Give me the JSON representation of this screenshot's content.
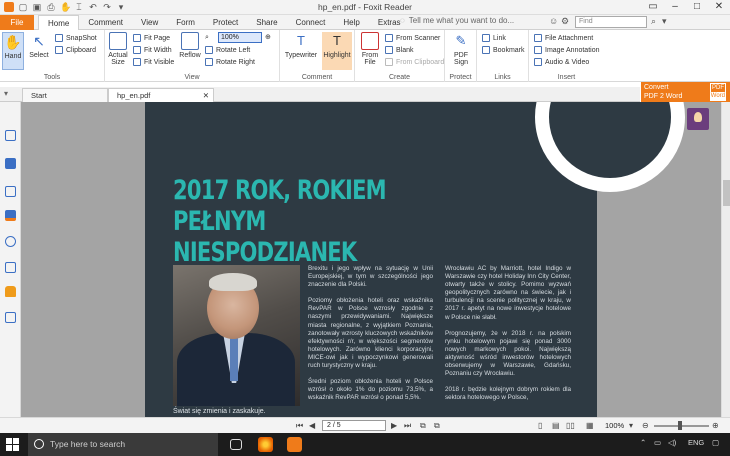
{
  "window": {
    "title": "hp_en.pdf - Foxit Reader"
  },
  "ribbon_tabs": [
    "File",
    "Home",
    "Comment",
    "View",
    "Form",
    "Protect",
    "Share",
    "Connect",
    "Help",
    "Extras"
  ],
  "active_tab": "Home",
  "tell_me": "Tell me what you want to do...",
  "find": {
    "placeholder": "Find"
  },
  "ribbon": {
    "tools": {
      "hand": "Hand",
      "select": "Select",
      "snapshot": "SnapShot",
      "clipboard": "Clipboard",
      "label": "Tools"
    },
    "view": {
      "actual_size": "Actual Size",
      "fit_page": "Fit Page",
      "fit_width": "Fit Width",
      "fit_visible": "Fit Visible",
      "reflow": "Reflow",
      "zoom": "100%",
      "rotate_left": "Rotate Left",
      "rotate_right": "Rotate Right",
      "label": "View"
    },
    "comment": {
      "typewriter": "Typewriter",
      "highlight": "Highlight",
      "label": "Comment"
    },
    "create": {
      "from_file": "From File",
      "from_scanner": "From Scanner",
      "blank": "Blank",
      "from_clipboard": "From Clipboard",
      "label": "Create"
    },
    "protect": {
      "pdf_sign": "PDF Sign",
      "label": "Protect"
    },
    "links": {
      "link": "Link",
      "bookmark": "Bookmark",
      "label": "Links"
    },
    "insert": {
      "file_attachment": "File Attachment",
      "image_annotation": "Image Annotation",
      "audio_video": "Audio & Video",
      "label": "Insert"
    }
  },
  "convert": {
    "line1": "Convert",
    "line2": "PDF 2 Word",
    "badge1": "PDF",
    "badge2": "Word"
  },
  "doc_tabs": [
    "Start",
    "hp_en.pdf"
  ],
  "document": {
    "title_line1": "2017 ROK, ROKIEM PEŁNYM",
    "title_line2": "NIESPODZIANEK",
    "col1": [
      "Brexitu i jego wpływ na sytuację w Unii Europejskiej, w tym w szczególności jego znaczenie dla Polski.",
      "Poziomy obłożenia hoteli oraz wskaźnika RevPAR w Polsce wzrosły zgodnie z naszymi przewidywaniami. Największe miasta regionalne, z wyjątkiem Poznania, zanotowały wzrosty kluczowych wskaźników efektywności r/r, w większości segmentów hotelowych. Zarówno klienci korporacyjni, MICE-owi jak i wypoczynkowi generowali ruch turystyczny w kraju.",
      "Średni poziom obłożenia hoteli w Polsce wzrósł o około 1% do poziomu 73,5%, a wskaźnik RevPAR wzrósł o ponad 5,5%."
    ],
    "col2": [
      "Wrocławiu AC by Marriott, hotel Indigo w Warszawie czy hotel Holiday Inn City Center, otwarty także w stolicy. Pomimo wyzwań geopolitycznych zarówno na świecie, jak i turbulencji na scenie politycznej w kraju, w 2017 r. apetyt na nowe inwestycje hotelowe w Polsce nie słabł.",
      "Prognozujemy, że w 2018 r. na polskim rynku hotelowym pojawi się ponad 3000 nowych markowych pokoi. Największą aktywność wśród inwestorów hotelowych obserwujemy w Warszawie, Gdańsku, Poznaniu czy Wrocławiu.",
      "2018 r. będzie kolejnym dobrym rokiem dla sektora hotelowego w Polsce,"
    ],
    "photo_caption": "Świat się zmienia i zaskakuje."
  },
  "status": {
    "page": "2 / 5",
    "zoom": "100%"
  },
  "taskbar": {
    "search_placeholder": "Type here to search",
    "lang": "ENG"
  }
}
